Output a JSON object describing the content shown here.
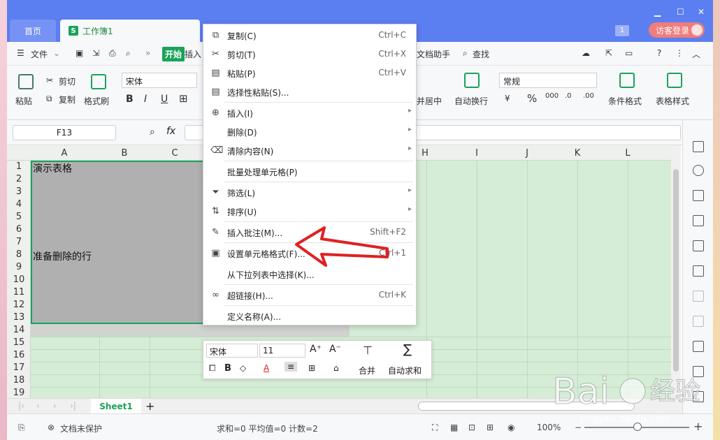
{
  "titlebar": {
    "tabs": [
      {
        "label": "首页"
      },
      {
        "label": "工作簿1",
        "icon": "S"
      }
    ],
    "badge": "1",
    "login_label": "访客登录"
  },
  "menubar": {
    "file_label": "文件",
    "start_label": "开始",
    "insert_label": "插入",
    "doc_helper_label": "文档助手",
    "find_label": "查找"
  },
  "ribbon": {
    "paste_label": "粘贴",
    "cut_label": "剪切",
    "copy_label": "复制",
    "format_painter_label": "格式刷",
    "font_name": "宋体",
    "bold": "B",
    "italic": "I",
    "underline": "U",
    "merge_center_label": "并居中",
    "wrap_label": "自动换行",
    "number_format": "常规",
    "percent": "%",
    "conditional_format_label": "条件格式",
    "table_style_label": "表格样式"
  },
  "formula_bar": {
    "cell_ref": "F13",
    "fx": "fx"
  },
  "grid": {
    "columns": [
      "A",
      "B",
      "C",
      "H",
      "I",
      "J",
      "K",
      "L"
    ],
    "rows": [
      "1",
      "2",
      "3",
      "4",
      "5",
      "6",
      "7",
      "8",
      "9",
      "10",
      "11",
      "12",
      "13",
      "14",
      "15",
      "16",
      "17",
      "18",
      "19"
    ],
    "cells": {
      "A1": "演示表格",
      "A8": "准备删除的行"
    }
  },
  "context_menu": {
    "items": [
      {
        "label": "复制(C)",
        "shortcut": "Ctrl+C",
        "icon": "copy-icon"
      },
      {
        "label": "剪切(T)",
        "shortcut": "Ctrl+X",
        "icon": "scissors-icon"
      },
      {
        "label": "粘贴(P)",
        "shortcut": "Ctrl+V",
        "icon": "paste-icon"
      },
      {
        "label": "选择性粘贴(S)...",
        "shortcut": "",
        "icon": "paste-special-icon"
      },
      {
        "label": "插入(I)",
        "shortcut": "",
        "icon": "insert-icon",
        "submenu": true
      },
      {
        "label": "删除(D)",
        "shortcut": "",
        "icon": "",
        "submenu": true
      },
      {
        "label": "清除内容(N)",
        "shortcut": "",
        "icon": "eraser-icon",
        "submenu": true
      },
      {
        "label": "批量处理单元格(P)",
        "shortcut": "",
        "icon": ""
      },
      {
        "label": "筛选(L)",
        "shortcut": "",
        "icon": "filter-icon",
        "submenu": true
      },
      {
        "label": "排序(U)",
        "shortcut": "",
        "icon": "sort-icon",
        "submenu": true
      },
      {
        "label": "插入批注(M)...",
        "shortcut": "Shift+F2",
        "icon": "comment-icon"
      },
      {
        "label": "设置单元格格式(F)...",
        "shortcut": "Ctrl+1",
        "icon": "format-cell-icon"
      },
      {
        "label": "从下拉列表中选择(K)...",
        "shortcut": "",
        "icon": ""
      },
      {
        "label": "超链接(H)...",
        "shortcut": "Ctrl+K",
        "icon": "link-icon"
      },
      {
        "label": "定义名称(A)...",
        "shortcut": "",
        "icon": ""
      }
    ]
  },
  "mini_toolbar": {
    "font_name": "宋体",
    "font_size": "11",
    "bold": "B",
    "merge_label": "合并",
    "autosum_label": "自动求和"
  },
  "sheets": {
    "tabs": [
      "Sheet1"
    ]
  },
  "statusbar": {
    "protect_label": "文档未保护",
    "stats": "求和=0   平均值=0   计数=2",
    "zoom": "100%"
  },
  "colors": {
    "titlebar": "#5b7ef0",
    "accent_green": "#1aa35a",
    "selection_gray": "#b0b0b0",
    "grid_bg": "#d5ecd6",
    "annotation_red": "#e02020"
  }
}
